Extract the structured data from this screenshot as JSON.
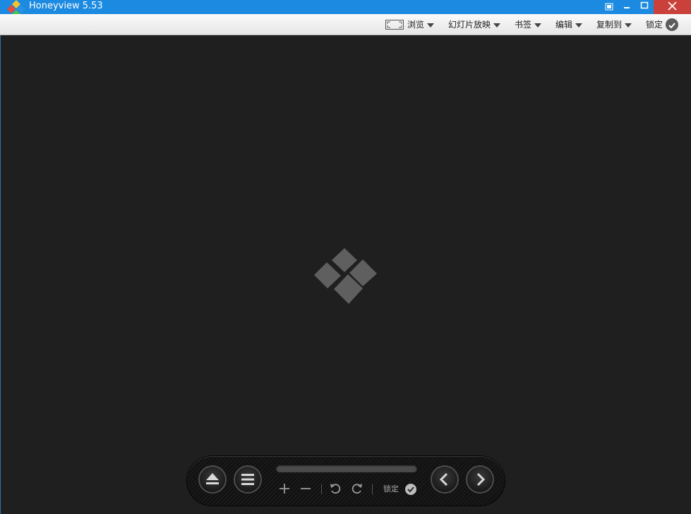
{
  "window": {
    "title": "Honeyview 5.53"
  },
  "menubar": {
    "items": [
      {
        "label": "浏览"
      },
      {
        "label": "幻灯片放映"
      },
      {
        "label": "书签"
      },
      {
        "label": "编辑"
      },
      {
        "label": "复制到"
      }
    ],
    "lock_label": "锁定"
  },
  "controls": {
    "lock_label": "锁定",
    "progress": 0.0
  },
  "colors": {
    "titlebar": "#1b8ae0",
    "close_button": "#c9413a",
    "canvas_background": "#1f1f1f"
  },
  "icons": {
    "app": "honeyview-diamond-logo",
    "center": "honeyview-diamond-logo-gray"
  }
}
